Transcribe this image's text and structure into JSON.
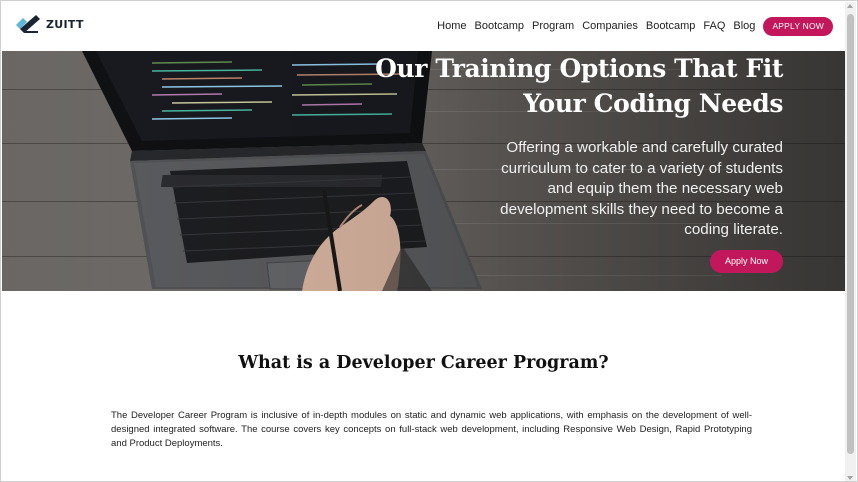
{
  "brand": {
    "name": "ZUITT",
    "logo_icon": "zuitt-logo-icon",
    "accent": "#c2185b"
  },
  "nav": {
    "links": [
      "Home",
      "Bootcamp",
      "Program",
      "Companies",
      "Bootcamp",
      "FAQ",
      "Blog"
    ],
    "cta": "APPLY NOW"
  },
  "hero": {
    "title": "Our Training Options That Fit Your Coding Needs",
    "subtitle": "Offering a workable and carefully curated curriculum to cater to a variety of students and equip them the necessary web development skills they need to become a coding literate.",
    "cta": "Apply Now",
    "image": "laptop-with-hand-photo"
  },
  "section": {
    "title": "What is a Developer Career Program?",
    "body": "The Developer Career Program is inclusive of in-depth modules on static and dynamic web applications, with emphasis on the development of well-designed integrated software. The course covers key concepts on full-stack web development, including Responsive Web Design, Rapid Prototyping and Product Deployments."
  }
}
